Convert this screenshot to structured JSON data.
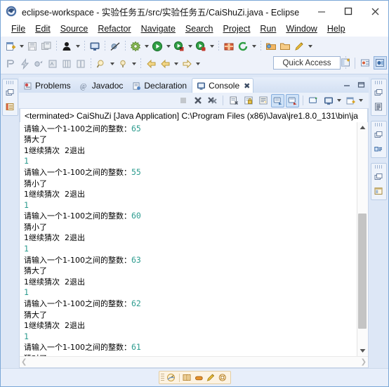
{
  "window": {
    "title": "eclipse-workspace - 实验任务五/src/实验任务五/CaiShuZi.java - Eclipse",
    "app_icon": "eclipse-icon",
    "controls": {
      "minimize": "minimize-button",
      "maximize": "maximize-button",
      "close": "close-button"
    }
  },
  "menu": {
    "items": [
      {
        "label": "File"
      },
      {
        "label": "Edit"
      },
      {
        "label": "Source"
      },
      {
        "label": "Refactor"
      },
      {
        "label": "Navigate"
      },
      {
        "label": "Search"
      },
      {
        "label": "Project"
      },
      {
        "label": "Run"
      },
      {
        "label": "Window"
      },
      {
        "label": "Help"
      }
    ]
  },
  "toolbar": {
    "quick_access": "Quick Access",
    "row1": [
      "new-wizard-icon",
      "new-dropdown",
      "save-icon",
      "save-all-icon",
      "sep",
      "debug-person-icon",
      "debug-dropdown",
      "sep",
      "print-screen-icon",
      "sep",
      "skip-breakpoints-icon",
      "sep",
      "build-icon",
      "build-dropdown",
      "run-icon",
      "run-dropdown",
      "debug-green-icon",
      "debug-dropdown2",
      "coverage-icon",
      "coverage-dropdown",
      "sep",
      "new-package-icon",
      "refresh-icon",
      "refresh-dropdown",
      "sep",
      "open-type-icon",
      "open-folder-icon",
      "pencil-icon",
      "pencil-dropdown"
    ],
    "row2": [
      "toggle-mark-icon",
      "quick-fix-icon",
      "next-annotation-icon",
      "prev-edit-icon",
      "table-icon",
      "column-icon",
      "sep",
      "search-icon",
      "search-dropdown",
      "last-edit-icon",
      "last-edit-dropdown",
      "sep",
      "back-arrow-icon",
      "left-arrow-icon",
      "left-dropdown",
      "right-arrow-icon",
      "right-dropdown"
    ],
    "perspective": [
      "open-perspective-icon",
      "java-perspective-icon",
      "java-ee-perspective-icon"
    ]
  },
  "rail_left": {
    "groups": [
      {
        "icons": [
          "restore-icon",
          "package-explorer-icon"
        ]
      }
    ]
  },
  "rail_right": {
    "groups": [
      {
        "icons": [
          "restore-icon",
          "outline-icon"
        ]
      },
      {
        "icons": [
          "restore-icon",
          "task-list-icon"
        ]
      },
      {
        "icons": [
          "restore-icon",
          "template-icon"
        ]
      }
    ]
  },
  "tabs": [
    {
      "label": "Problems",
      "icon": "problems-icon",
      "active": false
    },
    {
      "label": "Javadoc",
      "icon": "javadoc-icon",
      "active": false
    },
    {
      "label": "Declaration",
      "icon": "declaration-icon",
      "active": false
    },
    {
      "label": "Console",
      "icon": "console-icon",
      "active": true,
      "closable": true
    }
  ],
  "tab_actions": {
    "minimize": "minimize-view-button",
    "maximize": "maximize-view-button"
  },
  "console_toolbar": [
    {
      "name": "terminate-button",
      "state": "disabled"
    },
    {
      "name": "remove-launch-button",
      "state": "normal"
    },
    {
      "name": "remove-all-terminated-button",
      "state": "normal"
    },
    {
      "name": "clear-console-button",
      "state": "normal"
    },
    {
      "name": "scroll-lock-button",
      "state": "normal"
    },
    {
      "name": "word-wrap-button",
      "state": "normal"
    },
    {
      "name": "show-console-on-output-button",
      "state": "toggled"
    },
    {
      "name": "show-console-on-error-button",
      "state": "toggled"
    },
    {
      "name": "pin-console-button",
      "state": "normal"
    },
    {
      "name": "display-selected-console-button",
      "state": "normal"
    },
    {
      "name": "open-console-button",
      "state": "normal"
    }
  ],
  "console": {
    "header": "<terminated> CaiShuZi [Java Application] C:\\Program Files (x86)\\Java\\jre1.8.0_131\\bin\\ja",
    "prompt": "请输入一个1-100之间的整数：",
    "menu_line": "1继续猜次  2退出",
    "lines": [
      {
        "type": "prompt",
        "text": "请输入一个1-100之间的整数：",
        "value": "65"
      },
      {
        "type": "result",
        "text": "猜大了"
      },
      {
        "type": "menu",
        "text": "1继续猜次  2退出"
      },
      {
        "type": "input",
        "text": "1"
      },
      {
        "type": "prompt",
        "text": "请输入一个1-100之间的整数：",
        "value": "55"
      },
      {
        "type": "result",
        "text": "猜小了"
      },
      {
        "type": "menu",
        "text": "1继续猜次  2退出"
      },
      {
        "type": "input",
        "text": "1"
      },
      {
        "type": "prompt",
        "text": "请输入一个1-100之间的整数：",
        "value": "60"
      },
      {
        "type": "result",
        "text": "猜小了"
      },
      {
        "type": "menu",
        "text": "1继续猜次  2退出"
      },
      {
        "type": "input",
        "text": "1"
      },
      {
        "type": "prompt",
        "text": "请输入一个1-100之间的整数：",
        "value": "63"
      },
      {
        "type": "result",
        "text": "猜大了"
      },
      {
        "type": "menu",
        "text": "1继续猜次  2退出"
      },
      {
        "type": "input",
        "text": "1"
      },
      {
        "type": "prompt",
        "text": "请输入一个1-100之间的整数：",
        "value": "62"
      },
      {
        "type": "result",
        "text": "猜大了"
      },
      {
        "type": "menu",
        "text": "1继续猜次  2退出"
      },
      {
        "type": "input",
        "text": "1"
      },
      {
        "type": "prompt",
        "text": "请输入一个1-100之间的整数：",
        "value": "61"
      },
      {
        "type": "result",
        "text": "猜对了"
      }
    ],
    "input_color": "#2d9c8f"
  },
  "statusbar": {
    "icons": [
      "progress-icon",
      "book-icon",
      "hand-icon",
      "pencil-icon",
      "lifebuoy-icon"
    ]
  }
}
